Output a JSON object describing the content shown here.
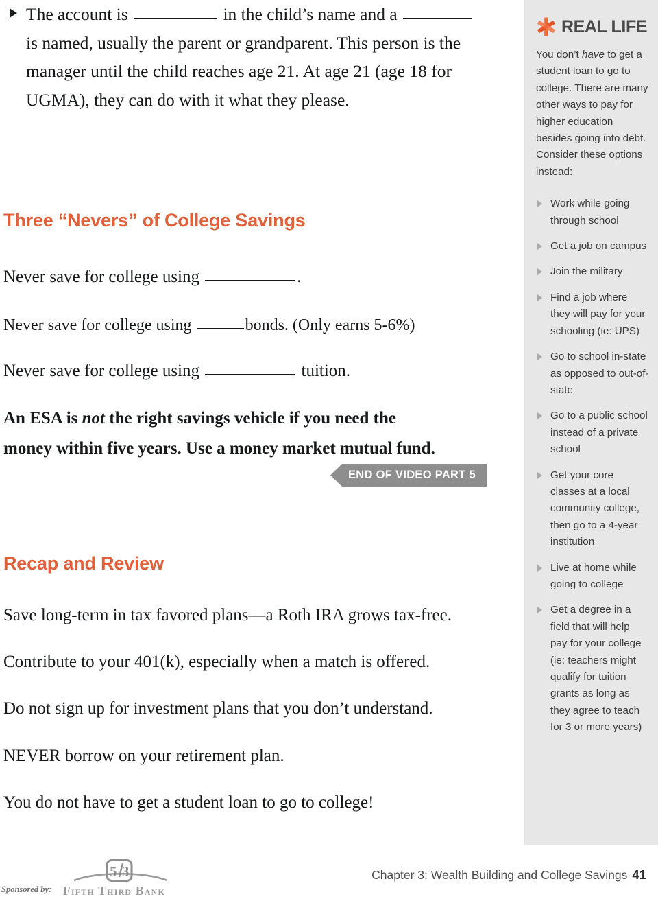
{
  "colors": {
    "accent_orange": "#e0603a",
    "sidebar_bg": "#e7e7e7",
    "banner_gray": "#8e8e8e",
    "body_text": "#17181a",
    "sidebar_text": "#3c3c3c"
  },
  "main": {
    "intro_bullet": {
      "part1": "The account is",
      "blank1": "",
      "part2": "in the child’s name and a",
      "blank2": "",
      "part3": "is named, usually the parent or grandparent. This person is the manager until the child reaches age 21. At age 21 (age 18 for UGMA), they can do with it what they please."
    },
    "nevers_heading": "Three “Nevers” of College Savings",
    "never_1": {
      "before": "Never save for college using",
      "after": "."
    },
    "never_2": {
      "before": "Never save for college using",
      "after": "bonds. (Only earns 5-6%)"
    },
    "never_3": {
      "before": "Never save for college using",
      "after": "tuition."
    },
    "esa_note": {
      "pre": "An ESA is",
      "italic": "not",
      "post": "the right savings vehicle if you need the money within five years. Use a money market mutual fund."
    },
    "video_banner": "END OF VIDEO PART 5",
    "recap_heading": "Recap and Review",
    "recap_lines": [
      "Save long-term in tax favored plans—a Roth IRA grows tax-free.",
      "Contribute to your 401(k), especially when a match is offered.",
      "Do not sign up for investment plans that you don’t understand.",
      "NEVER borrow on your retirement plan.",
      "You do not have to get a student loan to go to college!"
    ]
  },
  "sidebar": {
    "icon": "asterisk-starburst-icon",
    "title": "REAL LIFE",
    "intro": {
      "pre": "You don’t",
      "italic": "have",
      "post": "to get a student loan to go to college. There are many other ways to pay for higher education besides going into debt. Consider these options instead:"
    },
    "items": [
      "Work while going through school",
      "Get a job on campus",
      "Join the military",
      "Find a job where they will pay for your schooling (ie:  UPS)",
      "Go to school in-state as opposed to out-of-state",
      "Go to a public school instead of a private school",
      "Get your core classes at a local community college, then go to a 4-year institution",
      "Live at home while going to college",
      "Get a degree in a field that will help pay for your college (ie: teachers might qualify for tuition grants as long as they agree to teach for 3 or more years)"
    ]
  },
  "footer": {
    "chapter": "Chapter 3: Wealth Building and College Savings",
    "page_number": "41",
    "sponsored_label": "Sponsored by:",
    "bank_name": "Fifth Third Bank",
    "logo_mark": "fifth-third-53-logo"
  }
}
